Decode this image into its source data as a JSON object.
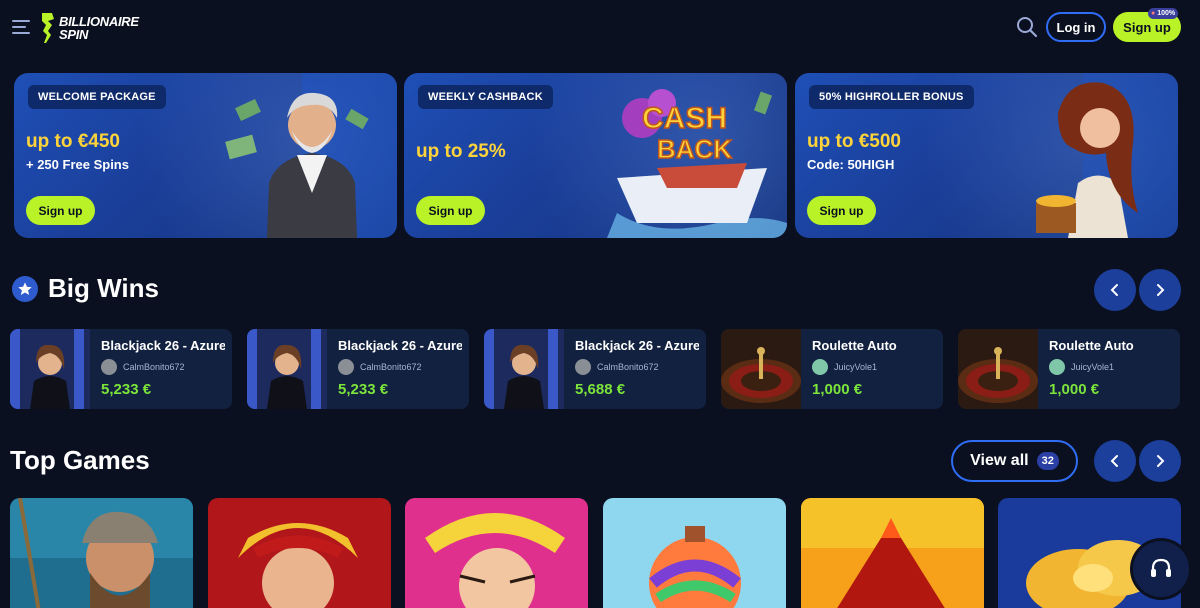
{
  "header": {
    "logo_line1": "BILLIONAIRE",
    "logo_line2": "SPIN",
    "login_label": "Log in",
    "signup_label": "Sign up",
    "signup_badge": "100%"
  },
  "promos": [
    {
      "tag": "WELCOME PACKAGE",
      "headline": "up to €450",
      "sub": "+ 250 Free Spins",
      "button": "Sign up"
    },
    {
      "tag": "WEEKLY CASHBACK",
      "headline": "up to 25%",
      "sub": "",
      "button": "Sign up",
      "art_text1": "CASH",
      "art_text2": "BACK"
    },
    {
      "tag": "50% HIGHROLLER BONUS",
      "headline": "up to €500",
      "sub": "Code: 50HIGH",
      "button": "Sign up"
    }
  ],
  "big_wins": {
    "title": "Big Wins",
    "items": [
      {
        "game": "Blackjack 26 - Azure",
        "user": "CalmBonito672",
        "amount": "5,233 €",
        "thumb": "dealer"
      },
      {
        "game": "Blackjack 26 - Azure",
        "user": "CalmBonito672",
        "amount": "5,233 €",
        "thumb": "dealer"
      },
      {
        "game": "Blackjack 26 - Azure",
        "user": "CalmBonito672",
        "amount": "5,688 €",
        "thumb": "dealer"
      },
      {
        "game": "Roulette Auto",
        "user": "JuicyVole1",
        "amount": "1,000 €",
        "thumb": "roulette"
      },
      {
        "game": "Roulette Auto",
        "user": "JuicyVole1",
        "amount": "1,000 €",
        "thumb": "roulette"
      }
    ]
  },
  "top_games": {
    "title": "Top Games",
    "view_all_label": "View all",
    "count": "32"
  },
  "colors": {
    "accent_lime": "#b9f227",
    "accent_blue": "#2f6df6",
    "win_green": "#7ce43a",
    "promo_yellow": "#ffd43a"
  }
}
